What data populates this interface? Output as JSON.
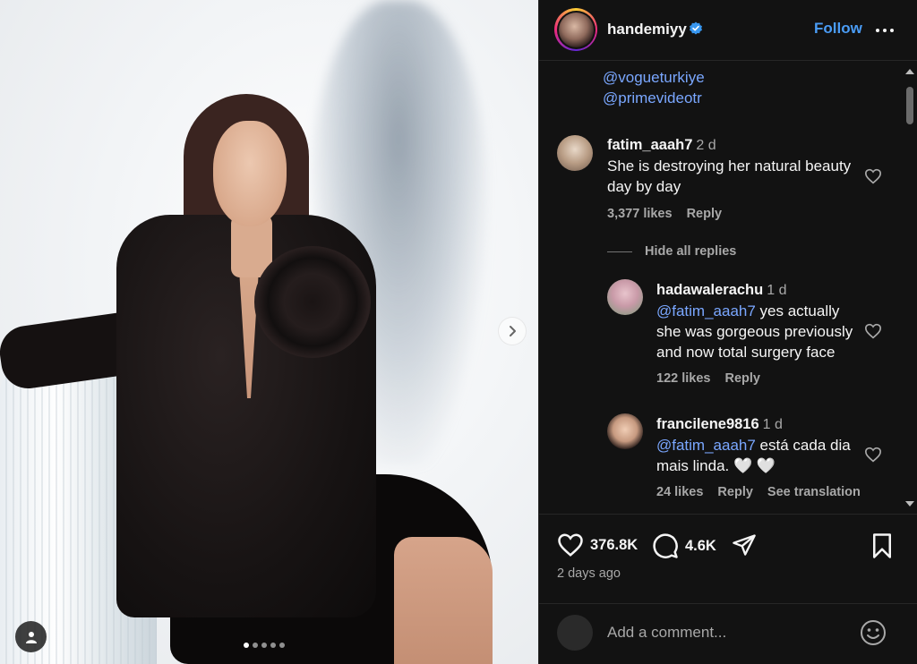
{
  "post": {
    "author": "handemiyy",
    "follow_label": "Follow",
    "caption_mentions": [
      "@vogueturkiye",
      "@primevideotr"
    ]
  },
  "comments": [
    {
      "user": "fatim_aaah7",
      "time": "2 d",
      "text": "She is destroying her natural beauty day by day",
      "likes": "3,377 likes",
      "reply_label": "Reply",
      "hide_replies_label": "Hide all replies",
      "replies": [
        {
          "user": "hadawalerachu",
          "time": "1 d",
          "mention": "@fatim_aaah7",
          "text": " yes actually she was gorgeous previously and now total surgery face",
          "likes": "122 likes",
          "reply_label": "Reply"
        },
        {
          "user": "francilene9816",
          "time": "1 d",
          "mention": "@fatim_aaah7",
          "text": " está cada dia mais linda. 🤍 🤍",
          "likes": "24 likes",
          "reply_label": "Reply",
          "translation_label": "See translation"
        }
      ]
    }
  ],
  "stats": {
    "likes": "376.8K",
    "comments": "4.6K",
    "posted": "2 days ago"
  },
  "composer": {
    "placeholder": "Add a comment..."
  },
  "colors": {
    "accent_link": "#4a9cf5",
    "mention": "#7aa7ff",
    "panel_bg": "#121212"
  }
}
